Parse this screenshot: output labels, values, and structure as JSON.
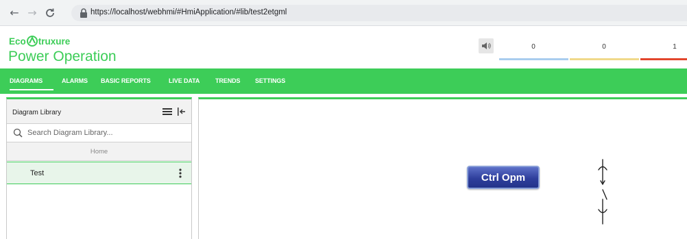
{
  "browser": {
    "back_icon": "arrow-left-icon",
    "forward_icon": "arrow-right-icon",
    "reload_icon": "reload-icon",
    "url": "https://localhost/webhmi/#HmiApplication/#lib/test2etgml"
  },
  "app": {
    "logo_left": "Eco",
    "logo_right": "truxure",
    "product": "Power Operation",
    "brand_color": "#3dcd58"
  },
  "alarm_status": {
    "speaker_icon": "speaker-icon",
    "counters": [
      {
        "count": "0",
        "color": "#a9cdee"
      },
      {
        "count": "0",
        "color": "#f0d98a"
      },
      {
        "count": "1",
        "color": "#e2462c"
      }
    ]
  },
  "nav": {
    "items": [
      "DIAGRAMS",
      "ALARMS",
      "BASIC REPORTS",
      "LIVE DATA",
      "TRENDS",
      "SETTINGS"
    ],
    "active": "DIAGRAMS"
  },
  "library": {
    "title": "Diagram Library",
    "menu_icon": "hamburger-menu-icon",
    "collapse_icon": "collapse-left-icon",
    "search_placeholder": "Search Diagram Library...",
    "breadcrumb": "Home",
    "items": [
      {
        "label": "Test"
      }
    ]
  },
  "canvas": {
    "button_label": "Ctrl Opm",
    "symbol_icon": "switch-breaker-icon"
  }
}
